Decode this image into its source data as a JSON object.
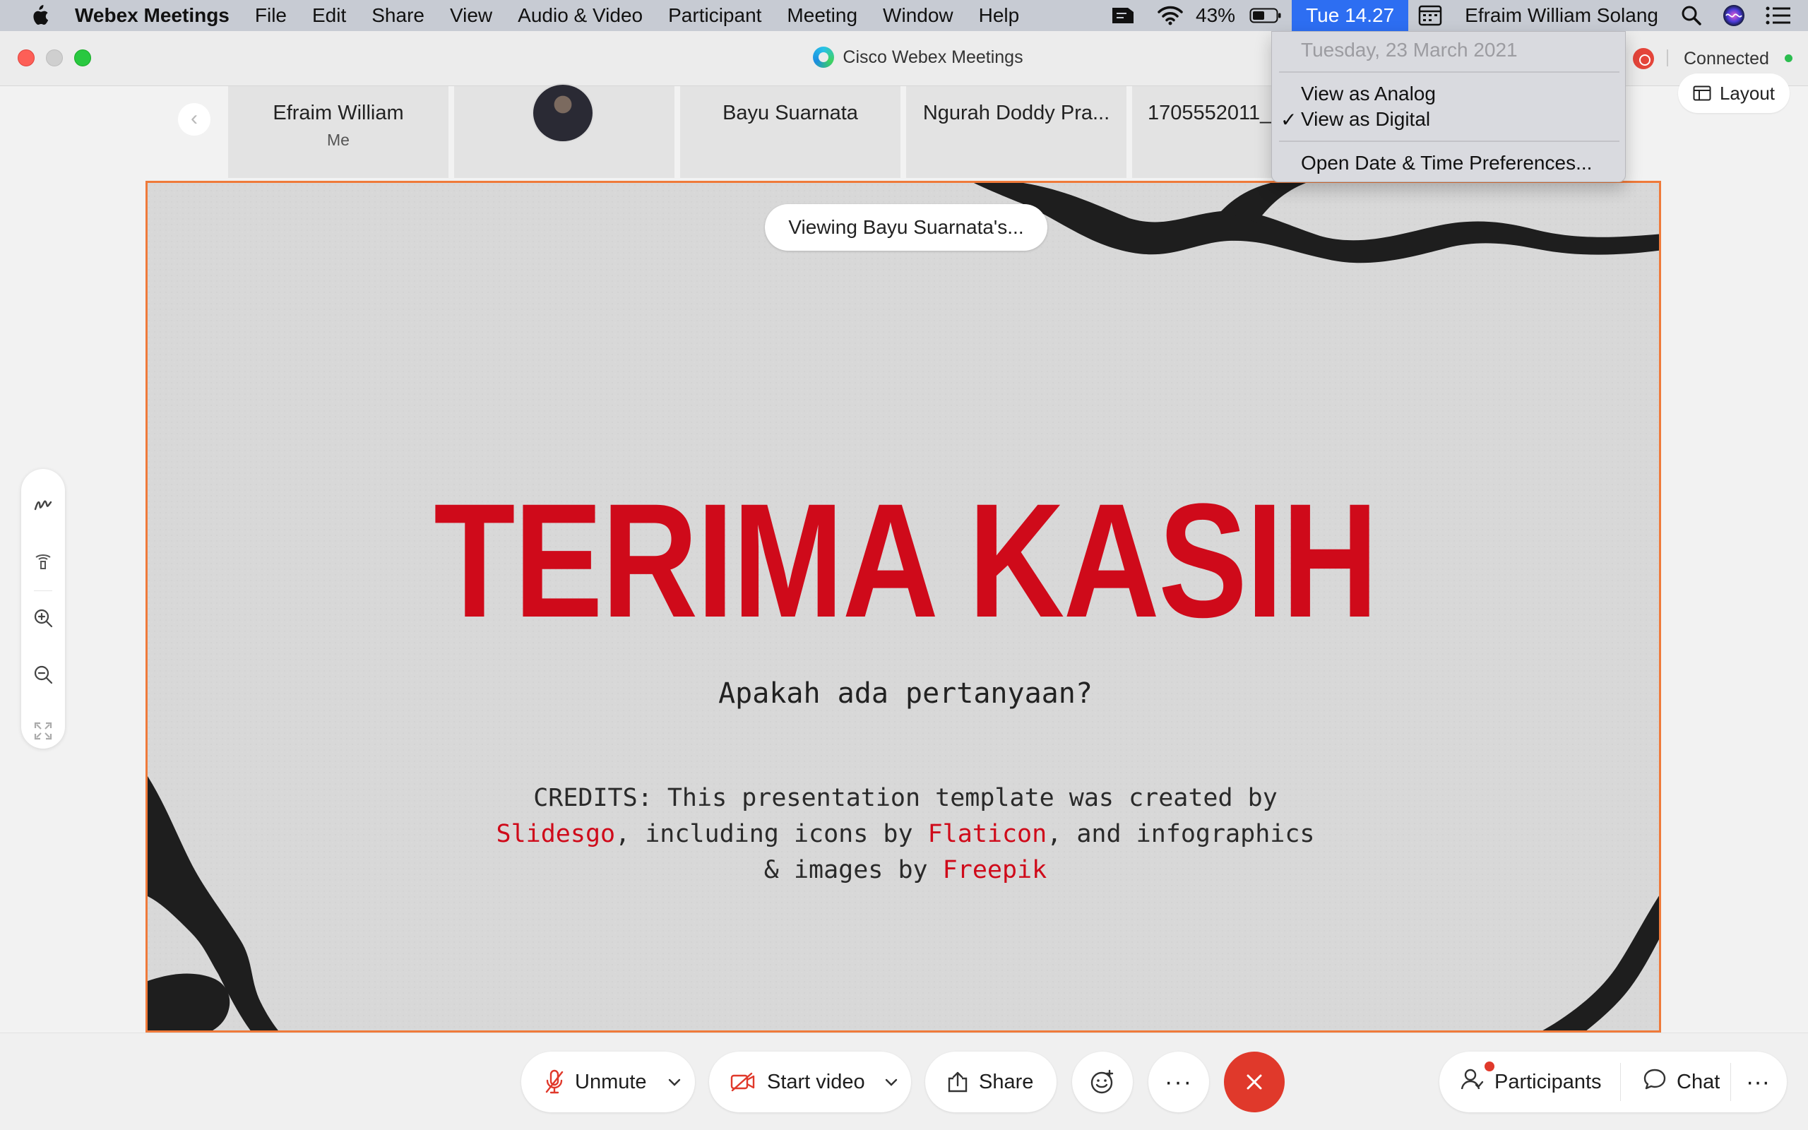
{
  "menubar": {
    "app_name": "Webex Meetings",
    "items": [
      "File",
      "Edit",
      "Share",
      "View",
      "Audio & Video",
      "Participant",
      "Meeting",
      "Window",
      "Help"
    ],
    "battery_percent": "43%",
    "clock": "Tue 14.27",
    "user": "Efraim William Solang"
  },
  "window": {
    "title": "Cisco Webex Meetings",
    "status": "Connected"
  },
  "participants_strip": {
    "tiles": [
      {
        "name": "Efraim William",
        "sub": "Me"
      },
      {
        "name": "",
        "sub": ""
      },
      {
        "name": "Bayu Suarnata",
        "sub": ""
      },
      {
        "name": "Ngurah Doddy Pra...",
        "sub": ""
      },
      {
        "name": "1705552011_",
        "sub": ""
      }
    ],
    "layout_label": "Layout"
  },
  "clock_menu": {
    "date": "Tuesday, 23 March 2021",
    "analog": "View as Analog",
    "digital": "View as Digital",
    "prefs": "Open Date & Time Preferences...",
    "check": "✓"
  },
  "share": {
    "viewing_label": "Viewing Bayu Suarnata's..."
  },
  "slide": {
    "title": "TERIMA KASIH",
    "subtitle": "Apakah ada pertanyaan?",
    "credits_1": "CREDITS: This presentation template was created by",
    "credits_link_1": "Slidesgo",
    "credits_2": ", including icons by ",
    "credits_link_2": "Flaticon",
    "credits_3": ", and infographics",
    "credits_4": "& images by ",
    "credits_link_3": "Freepik",
    "accent_color": "#cf0a1a"
  },
  "controls": {
    "unmute": "Unmute",
    "start_video": "Start video",
    "share": "Share",
    "more": "···",
    "participants": "Participants",
    "chat": "Chat",
    "end_color": "#e0392b"
  }
}
